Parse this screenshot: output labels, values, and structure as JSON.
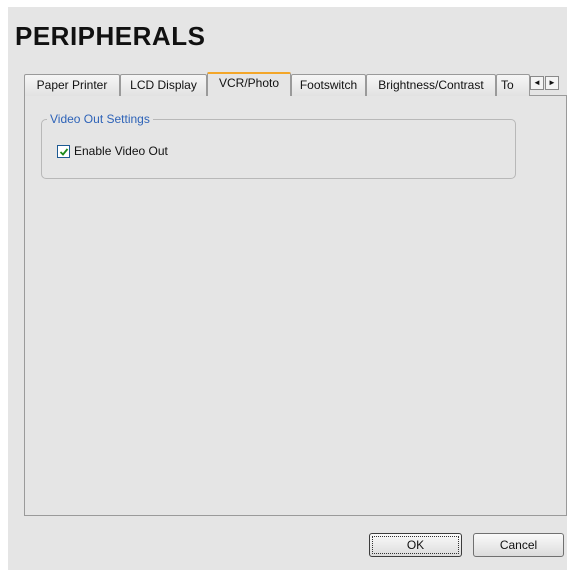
{
  "title": "PERIPHERALS",
  "tabs": [
    {
      "label": "Paper Printer",
      "active": false
    },
    {
      "label": "LCD Display",
      "active": false
    },
    {
      "label": "VCR/Photo",
      "active": true
    },
    {
      "label": "Footswitch",
      "active": false
    },
    {
      "label": "Brightness/Contrast",
      "active": false
    },
    {
      "label": "To",
      "active": false
    }
  ],
  "tab_scroll": {
    "left_icon": "arrow-left-icon",
    "right_icon": "arrow-right-icon",
    "left_glyph": "◄",
    "right_glyph": "►"
  },
  "group": {
    "legend": "Video Out Settings"
  },
  "checkbox": {
    "label": "Enable Video Out",
    "checked": true
  },
  "buttons": {
    "ok": "OK",
    "cancel": "Cancel"
  },
  "colors": {
    "active_tab_accent": "#f3a629",
    "group_legend": "#2e63b8",
    "dialog_bg": "#e5e5e5"
  }
}
